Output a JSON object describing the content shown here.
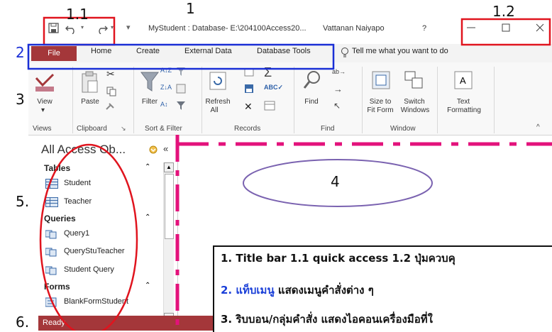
{
  "callouts": {
    "n1": "1",
    "n11": "1.1",
    "n12": "1.2",
    "n2": "2",
    "n3": "3",
    "n4": "4",
    "n5": "5.",
    "n6": "6."
  },
  "titlebar": {
    "title": "MyStudent : Database- E:\\204100Access20...",
    "user": "Vattanan Naiyapo",
    "help": "?"
  },
  "tabs": {
    "file": "File",
    "home": "Home",
    "create": "Create",
    "external": "External Data",
    "dbtools": "Database Tools",
    "tellme": "Tell me what you want to do"
  },
  "ribbon": {
    "view": "View",
    "paste": "Paste",
    "filter": "Filter",
    "refresh": "Refresh",
    "refresh_all": "All",
    "find": "Find",
    "size_to": "Size to",
    "fit_form": "Fit Form",
    "switch": "Switch",
    "windows": "Windows",
    "text": "Text",
    "formatting": "Formatting",
    "groups": {
      "views": "Views",
      "clipboard": "Clipboard",
      "sort_filter": "Sort & Filter",
      "records": "Records",
      "find": "Find",
      "window": "Window"
    }
  },
  "nav": {
    "header": "All Access Ob...",
    "sections": {
      "tables": "Tables",
      "queries": "Queries",
      "forms": "Forms"
    },
    "tables": [
      "Student",
      "Teacher"
    ],
    "queries": [
      "Query1",
      "QueryStuTeacher",
      "Student Query"
    ],
    "forms": [
      "BlankFormStudent"
    ]
  },
  "status": {
    "ready": "Ready"
  },
  "notes": {
    "line1": "1. Title bar    1.1 quick access    1.2 ปุ่มควบคุ",
    "line2_num": "2. แท็บเมนู",
    "line2_rest": " แสดงเมนูคำสั่งต่าง ๆ",
    "line3": "3. ริบบอน/กลุ่มคำสั่ง แสดงไอคอนเครื่องมือที่ใ"
  },
  "colors": {
    "file_tab": "#a4373a",
    "annotation_red": "#e0141e",
    "annotation_blue": "#1a2fd6",
    "annotation_pink": "#e3127b",
    "ellipse": "#7a62b0",
    "note_blue": "#1a3fd8"
  }
}
